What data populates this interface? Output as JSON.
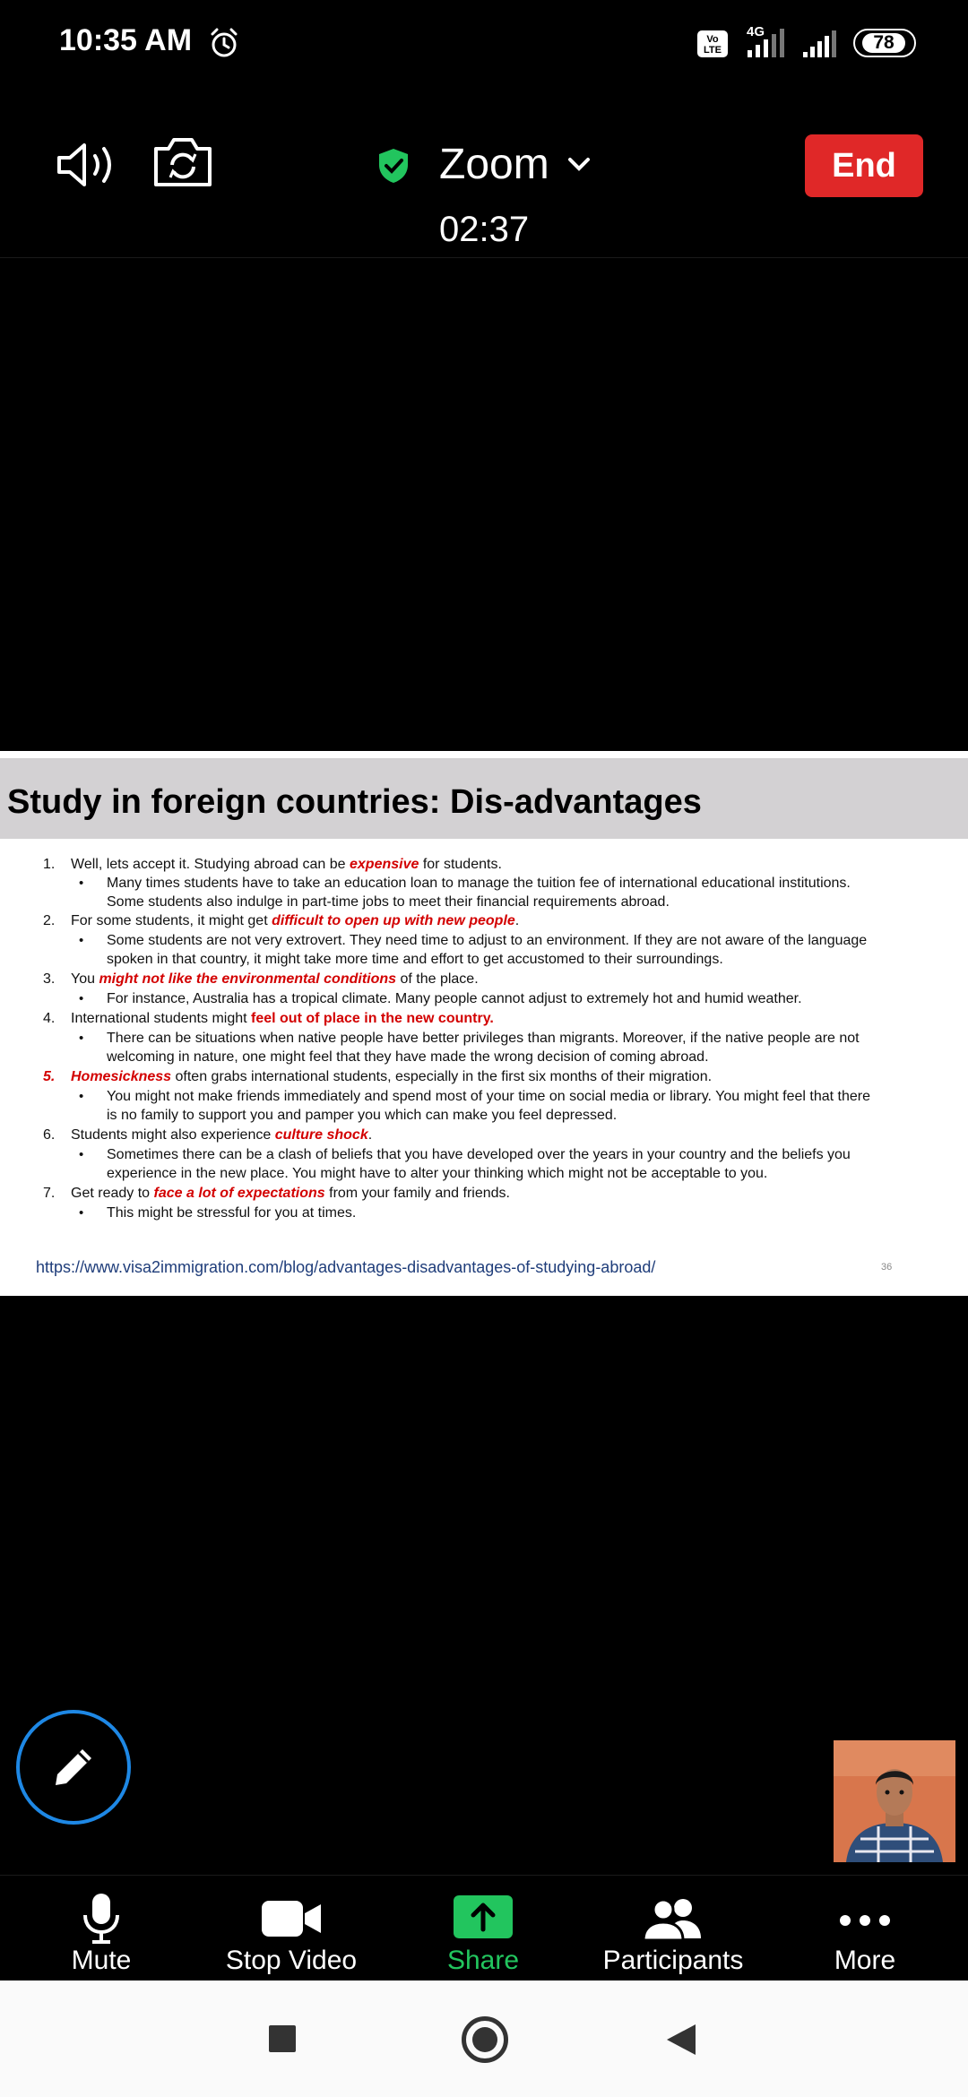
{
  "status_bar": {
    "time": "10:35 AM",
    "volte": "Vo LTE",
    "network": "4G",
    "battery": "78"
  },
  "meeting": {
    "app_name": "Zoom",
    "timer": "02:37",
    "end_label": "End"
  },
  "slide": {
    "title": "Study in foreign countries: Dis-advantages",
    "items": [
      {
        "num": "1.",
        "pre": "Well, lets accept it. Studying abroad can be ",
        "highlight": "expensive",
        "post": " for students.",
        "bullets": [
          [
            "Many times students have to take an education loan to manage the tuition fee of international educational institutions.",
            "Some students also indulge in part-time jobs to meet their financial requirements abroad."
          ]
        ]
      },
      {
        "num": "2.",
        "pre": "For some students, it might get ",
        "highlight": "difficult to open up with new people",
        "post": ".",
        "bullets": [
          [
            "Some students are not very extrovert. They need time to adjust to an environment. If they are not aware of the language",
            "spoken in that country, it might take more time and effort to get accustomed to their surroundings."
          ]
        ]
      },
      {
        "num": "3.",
        "pre": "You ",
        "highlight": "might not like the environmental conditions",
        "post": " of the place.",
        "bullets": [
          [
            "For instance, Australia has a tropical climate. Many people cannot adjust to extremely hot and humid weather."
          ]
        ]
      },
      {
        "num": "4.",
        "pre": "International students might ",
        "highlight": "feel out of place in the new country",
        "post": ".",
        "bullets": [
          [
            "There can be situations when native people have better privileges than migrants. Moreover, if the native people are not",
            "welcoming in nature, one might feel that they have made the wrong decision of coming abroad."
          ]
        ]
      },
      {
        "num": "5.",
        "pre": "",
        "highlight": "Homesickness",
        "post": " often grabs international students, especially in the first six months of their migration.",
        "bullets": [
          [
            "You might not make friends immediately and spend most of your time on social media or library. You might feel that there",
            "is no family to support you and pamper you which can make you feel depressed."
          ]
        ]
      },
      {
        "num": "6.",
        "pre": "Students might also experience ",
        "highlight": "culture shock",
        "post": ".",
        "bullets": [
          [
            "Sometimes there can be a clash of beliefs that you have developed over the years in your country and the beliefs you",
            "experience in the new place. You might have to alter your thinking which might not be acceptable to you."
          ]
        ]
      },
      {
        "num": "7.",
        "pre": "Get ready to ",
        "highlight": "face a lot of expectations",
        "post": " from your family and friends.",
        "bullets": [
          [
            "This might be stressful for you at times."
          ]
        ]
      }
    ],
    "url": "https://www.visa2immigration.com/blog/advantages-disadvantages-of-studying-abroad/",
    "page_number": "36"
  },
  "toolbar": {
    "mute_label": "Mute",
    "stop_video_label": "Stop Video",
    "share_label": "Share",
    "participants_label": "Participants",
    "more_label": "More"
  },
  "colors": {
    "end_button": "#e02828",
    "share_accent": "#22c55e",
    "highlight_text": "#d30000",
    "annotate_ring": "#1e88e5"
  }
}
